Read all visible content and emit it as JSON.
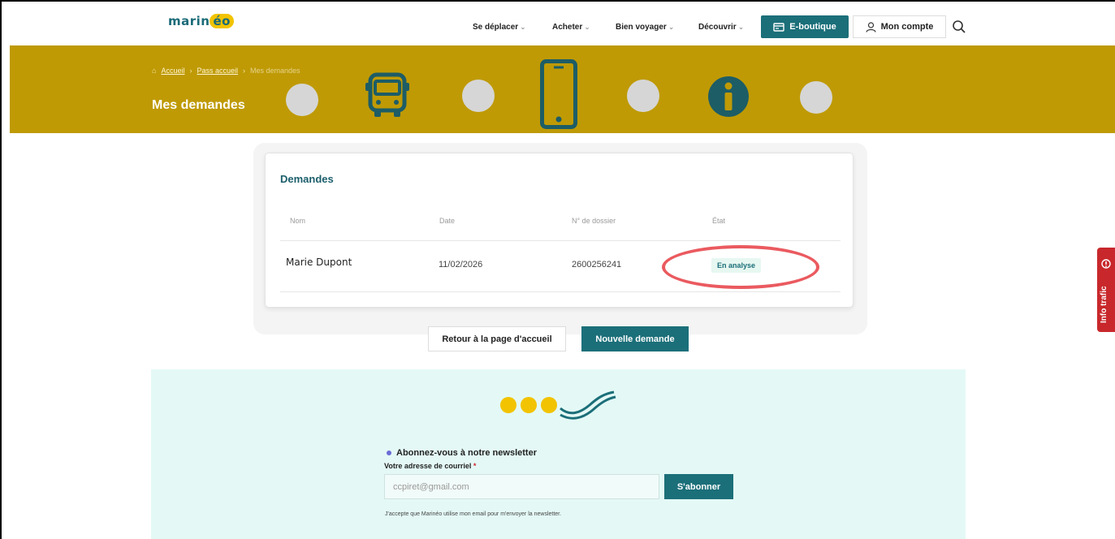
{
  "header": {
    "logo_text": "marinéo",
    "nav": [
      {
        "label": "Se déplacer"
      },
      {
        "label": "Acheter"
      },
      {
        "label": "Bien voyager"
      },
      {
        "label": "Découvrir"
      }
    ],
    "eboutique_label": "E-boutique",
    "account_label": "Mon compte",
    "icons": {
      "search": "search-icon",
      "account": "user-icon",
      "eboutique": "card-icon"
    }
  },
  "banner": {
    "background_color": "#bf9a05",
    "breadcrumb": [
      {
        "label": "Accueil"
      },
      {
        "label": "Pass accueil"
      },
      {
        "label": "Mes demandes"
      }
    ],
    "title": "Mes demandes"
  },
  "requests": {
    "title": "Demandes",
    "columns": [
      "Nom",
      "Date",
      "N° de dossier",
      "État"
    ],
    "rows": [
      {
        "name": "Marie Dupont",
        "date": "11/02/2026",
        "file_number": "2600256241",
        "status": "En analyse"
      }
    ]
  },
  "actions": {
    "back_label": "Retour à la page d'accueil",
    "new_request_label": "Nouvelle demande"
  },
  "newsletter": {
    "title": "Abonnez-vous à notre newsletter",
    "email_label": "Votre adresse de courriel",
    "required_mark": "*",
    "email_value": "ccpiret@gmail.com",
    "subscribe_label": "S'abonner",
    "consent_text": "J'accepte que Marinéo utilise mon email pour m'envoyer la newsletter."
  },
  "side_tab": {
    "label": "Info trafic"
  },
  "colors": {
    "accent": "#1b6f79",
    "banner": "#bf9a05",
    "highlight": "#ea5a5f",
    "alert": "#c8282c"
  }
}
